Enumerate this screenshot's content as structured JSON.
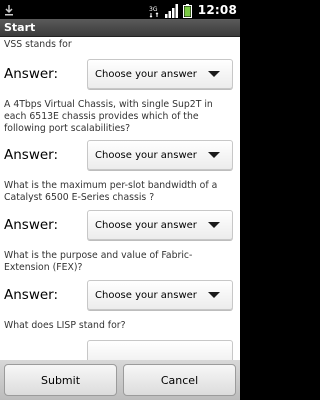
{
  "status_bar": {
    "time": "12:08",
    "network": "3G"
  },
  "title": "Start",
  "questions": [
    {
      "text": "VSS stands for",
      "answer_label": "Answer:",
      "select_placeholder": "Choose your answer"
    },
    {
      "text": "A 4Tbps Virtual Chassis, with single Sup2T in each 6513E chassis provides which of the following port scalabilities?",
      "answer_label": "Answer:",
      "select_placeholder": "Choose your answer"
    },
    {
      "text": "What is the maximum per-slot bandwidth of a Catalyst 6500 E-Series chassis ?",
      "answer_label": "Answer:",
      "select_placeholder": "Choose your answer"
    },
    {
      "text": "What is the purpose and value of Fabric-Extension (FEX)?",
      "answer_label": "Answer:",
      "select_placeholder": "Choose your answer"
    },
    {
      "text": "What does LISP stand for?"
    }
  ],
  "buttons": {
    "submit": "Submit",
    "cancel": "Cancel"
  }
}
